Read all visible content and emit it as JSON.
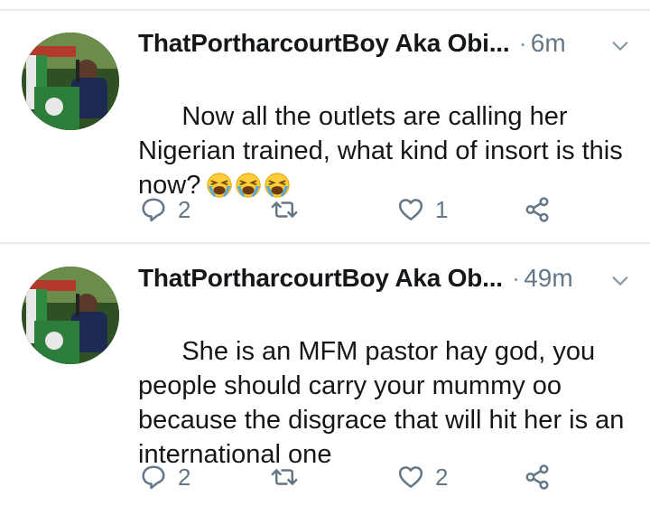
{
  "tweets": [
    {
      "author": "ThatPortharcourtBoy Aka Obi...",
      "time": "6m",
      "text": "Now all the outlets are calling her Nigerian trained, what kind of insort is this now?",
      "emoji": [
        "loudly-crying-face",
        "loudly-crying-face",
        "loudly-crying-face"
      ],
      "replies": "2",
      "retweets": "",
      "likes": "1"
    },
    {
      "author": "ThatPortharcourtBoy Aka Ob...",
      "time": "49m",
      "text": "She is an MFM pastor hay god, you people should carry your mummy oo because the disgrace that will hit her is an international one",
      "emoji": [],
      "replies": "2",
      "retweets": "",
      "likes": "2"
    }
  ],
  "separator": "·",
  "colors": {
    "icon": "#657786",
    "divider": "#e6ecf0",
    "text": "#14171a"
  }
}
